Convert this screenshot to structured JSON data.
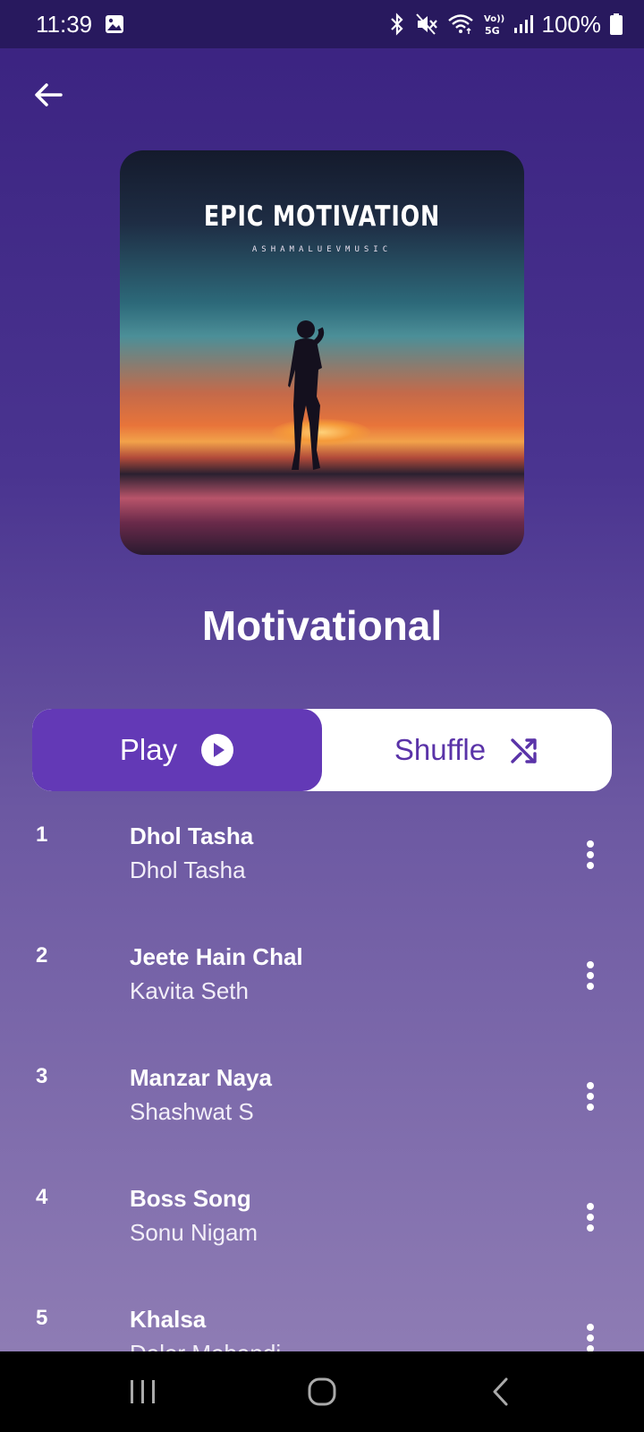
{
  "status_bar": {
    "time": "11:39",
    "battery": "100%",
    "icons": [
      "gallery-icon",
      "bluetooth-icon",
      "mute-icon",
      "wifi-icon",
      "volte-5g-icon",
      "signal-icon",
      "battery-icon"
    ],
    "volte_label": "Vo)) 5G"
  },
  "header": {
    "back_icon": "arrow-left-icon"
  },
  "album_art": {
    "title": "EPIC MOTIVATION",
    "subtitle": "ASHAMALUEVMUSIC"
  },
  "playlist": {
    "title": "Motivational"
  },
  "actions": {
    "play_label": "Play",
    "shuffle_label": "Shuffle"
  },
  "tracks": [
    {
      "num": "1",
      "title": "Dhol Tasha",
      "artist": "Dhol Tasha"
    },
    {
      "num": "2",
      "title": "Jeete Hain Chal",
      "artist": "Kavita Seth"
    },
    {
      "num": "3",
      "title": "Manzar Naya",
      "artist": "Shashwat S"
    },
    {
      "num": "4",
      "title": "Boss Song",
      "artist": "Sonu Nigam"
    },
    {
      "num": "5",
      "title": "Khalsa",
      "artist": "Daler Mehandi"
    }
  ],
  "colors": {
    "accent": "#6339b6",
    "status_bar": "#28195e"
  }
}
